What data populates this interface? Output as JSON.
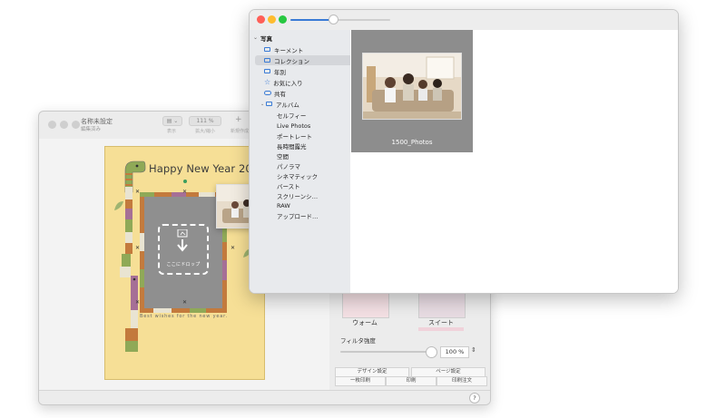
{
  "editor": {
    "doc_title": "名称未設定",
    "doc_subtitle": "編集済み",
    "toolbar": {
      "view_label": "表示",
      "zoom_value": "111 %",
      "zoom_label": "拡大/縮小",
      "add_label": "+",
      "edit_label": "新規作成"
    },
    "card": {
      "title": "Happy New Year 2025",
      "message": "Best wishes for the new year.",
      "drop_label": "ここにドロップ"
    },
    "panel": {
      "swatches": [
        {
          "label": "ウォーム",
          "color": "#e7c9cf"
        },
        {
          "label": "スイート",
          "color": "#d4c6cf"
        }
      ],
      "filter_label": "フィルタ強度",
      "filter_value": "100 %",
      "filter_level": 1.0,
      "design_button": "デザイン設定",
      "page_button": "ページ設定",
      "print_one": "一枚印刷",
      "print": "印刷",
      "print_order": "印刷注文"
    },
    "help_label": "?"
  },
  "photos": {
    "sidebar": {
      "section": "写真",
      "items": [
        {
          "label": "キーメント",
          "icon": "folder-icon"
        },
        {
          "label": "コレクション",
          "icon": "folder-icon",
          "selected": true
        },
        {
          "label": "年別",
          "icon": "folder-icon"
        },
        {
          "label": "お気に入り",
          "icon": "star-icon"
        },
        {
          "label": "共有",
          "icon": "cloud-icon"
        },
        {
          "label": "アルバム",
          "icon": "folder-icon",
          "expanded": true
        }
      ],
      "albums": [
        "セルフィー",
        "Live Photos",
        "ポートレート",
        "長時間露光",
        "空間",
        "パノラマ",
        "シネマティック",
        "バースト",
        "スクリーンシ…",
        "RAW",
        "アップロード…"
      ]
    },
    "grid": {
      "items": [
        {
          "label": "1500_Photos"
        }
      ]
    }
  },
  "colors": {
    "card_bg": "#f6df96",
    "frame": "#c37a3d",
    "accent_blue": "#3a7bd5",
    "close": "#ff5f57",
    "minimize": "#febc2e",
    "zoom": "#28c840"
  }
}
